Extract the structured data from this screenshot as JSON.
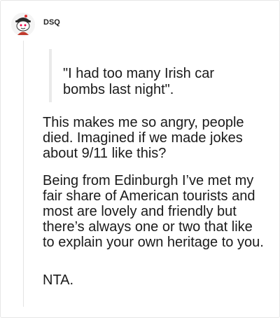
{
  "post": {
    "username": "DSQ",
    "quote": "\"I had too many Irish car bombs last night\".",
    "paragraphs": [
      "This makes me so angry, people died. Imagined if we made jokes about 9/11 like this?",
      "Being from Edinburgh I’ve met my fair share of American tourists and most are lovely and friendly but there’s always one or two that like to explain your own heritage to you.",
      "NTA."
    ]
  },
  "colors": {
    "background": "#ffffff",
    "text": "#1a1a1a",
    "thread_line": "#e3e3e3",
    "quote_bar": "#eaeaea"
  },
  "icons": {
    "avatar": "reddit-snoo-avatar-icon"
  }
}
